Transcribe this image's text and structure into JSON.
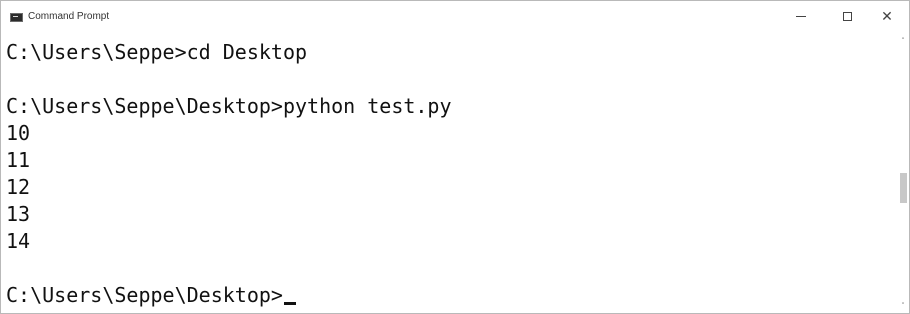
{
  "window": {
    "title": "Command Prompt",
    "icon": "cmd-icon"
  },
  "titlebar_controls": {
    "minimize_icon": "minimize-icon",
    "maximize_icon": "maximize-icon",
    "close_icon": "close-icon",
    "close_glyph": "✕"
  },
  "console": {
    "lines": [
      "C:\\Users\\Seppe>cd Desktop",
      "",
      "C:\\Users\\Seppe\\Desktop>python test.py",
      "10",
      "11",
      "12",
      "13",
      "14",
      "",
      "C:\\Users\\Seppe\\Desktop>"
    ]
  },
  "scrollbar": {
    "up_arrow": "˄",
    "down_arrow": "˅"
  }
}
